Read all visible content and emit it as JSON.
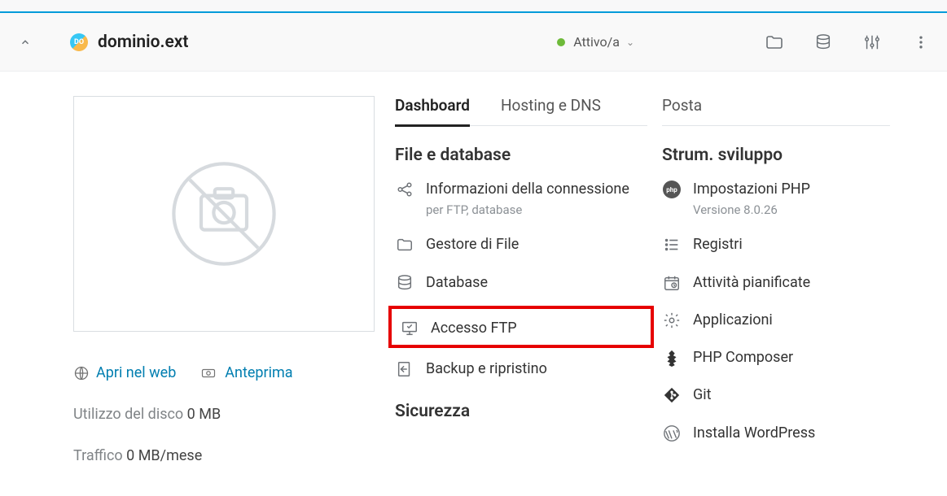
{
  "header": {
    "domain_icon_text": "DO",
    "domain_title": "dominio.ext",
    "status_label": "Attivo/a"
  },
  "left": {
    "open_web": "Apri nel web",
    "preview": "Anteprima",
    "disk_label": "Utilizzo del disco ",
    "disk_value": "0 MB",
    "traffic_label": "Traffico ",
    "traffic_value": "0 MB/mese"
  },
  "tabs": {
    "dashboard": "Dashboard",
    "hosting": "Hosting e DNS",
    "mail": "Posta"
  },
  "sections": {
    "files_db": "File e database",
    "security": "Sicurezza",
    "dev_tools": "Strum. sviluppo"
  },
  "items": {
    "conn_info": "Informazioni della connessione",
    "conn_info_sub": "per FTP, database",
    "file_manager": "Gestore di File",
    "database": "Database",
    "ftp_access": "Accesso FTP",
    "backup": "Backup e ripristino",
    "php_settings": "Impostazioni PHP",
    "php_version": "Versione 8.0.26",
    "logs": "Registri",
    "scheduled": "Attività pianificate",
    "apps": "Applicazioni",
    "composer": "PHP Composer",
    "git": "Git",
    "install_wp": "Installa WordPress"
  }
}
